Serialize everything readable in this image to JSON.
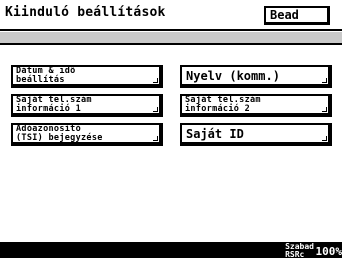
{
  "header": {
    "title": "Kiinduló beállítások",
    "enter_label": "Bead"
  },
  "buttons": [
    {
      "line1": "Dátum & idő",
      "line2": "beállítás"
    },
    {
      "label": "Nyelv (komm.)"
    },
    {
      "line1": "Saját tel.szám",
      "line2": "információ 1"
    },
    {
      "line1": "Saját tel.szám",
      "line2": "információ 2"
    },
    {
      "line1": "Adóazonosító",
      "line2": "(TSI) bejegyzése"
    },
    {
      "label": "Saját ID"
    }
  ],
  "status": {
    "memory_label_1": "Szabad",
    "memory_label_2": "RSRc",
    "memory_value": "100%"
  }
}
